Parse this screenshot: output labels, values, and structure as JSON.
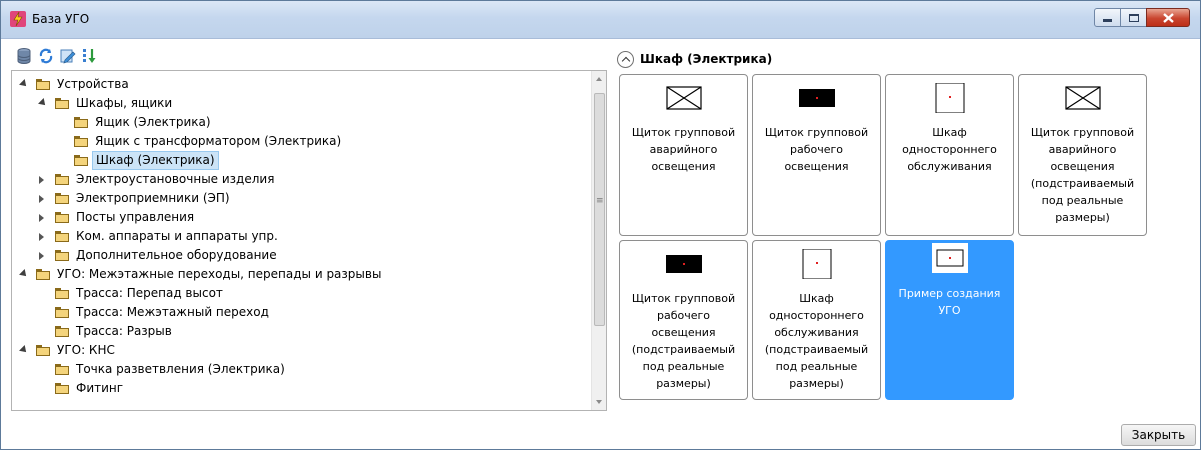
{
  "window": {
    "title": "База УГО",
    "accent_color": "#e0457b"
  },
  "toolbar": {
    "icons": [
      "database-icon",
      "refresh-icon",
      "edit-icon",
      "sort-icon"
    ]
  },
  "tree": {
    "items": [
      {
        "label": "Устройства",
        "level": 0,
        "state": "open"
      },
      {
        "label": "Шкафы, ящики",
        "level": 1,
        "state": "open"
      },
      {
        "label": "Ящик (Электрика)",
        "level": 2,
        "state": "leaf"
      },
      {
        "label": "Ящик с трансформатором (Электрика)",
        "level": 2,
        "state": "leaf"
      },
      {
        "label": "Шкаф (Электрика)",
        "level": 2,
        "state": "leaf",
        "selected": true
      },
      {
        "label": "Электроустановочные изделия",
        "level": 1,
        "state": "closed"
      },
      {
        "label": "Электроприемники (ЭП)",
        "level": 1,
        "state": "closed"
      },
      {
        "label": "Посты управления",
        "level": 1,
        "state": "closed"
      },
      {
        "label": "Ком. аппараты и аппараты упр.",
        "level": 1,
        "state": "closed"
      },
      {
        "label": "Дополнительное оборудование",
        "level": 1,
        "state": "closed"
      },
      {
        "label": "УГО: Межэтажные переходы, перепады и разрывы",
        "level": 0,
        "state": "open"
      },
      {
        "label": "Трасса: Перепад высот",
        "level": 1,
        "state": "leaf"
      },
      {
        "label": "Трасса: Межэтажный переход",
        "level": 1,
        "state": "leaf"
      },
      {
        "label": "Трасса: Разрыв",
        "level": 1,
        "state": "leaf"
      },
      {
        "label": "УГО: КНС",
        "level": 0,
        "state": "open"
      },
      {
        "label": "Точка разветвления (Электрика)",
        "level": 1,
        "state": "leaf"
      },
      {
        "label": "Фитинг",
        "level": 1,
        "state": "leaf"
      }
    ]
  },
  "gallery": {
    "section_title": "Шкаф (Электрика)",
    "tiles": [
      {
        "label": "Щиток групповой аварийного освещения",
        "thumb": "cross",
        "selected": false
      },
      {
        "label": "Щиток групповой рабочего освещения",
        "thumb": "black",
        "selected": false
      },
      {
        "label": "Шкаф одностороннего обслуживания",
        "thumb": "box",
        "selected": false
      },
      {
        "label": "Щиток групповой аварийного освещения (подстраиваемый под реальные размеры)",
        "thumb": "cross",
        "selected": false
      },
      {
        "label": "Щиток групповой рабочего освещения (подстраиваемый под реальные размеры)",
        "thumb": "black",
        "selected": false
      },
      {
        "label": "Шкаф одностороннего обслуживания (подстраиваемый под реальные размеры)",
        "thumb": "box",
        "selected": false
      },
      {
        "label": "Пример создания УГО",
        "thumb": "box-small",
        "selected": true
      }
    ],
    "selected_color": "#3399ff"
  },
  "footer": {
    "close_label": "Закрыть"
  }
}
